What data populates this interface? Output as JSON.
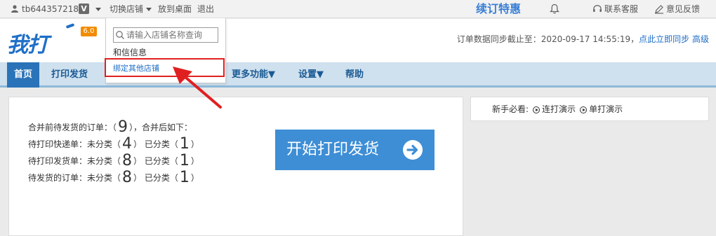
{
  "topbar": {
    "username": "tb644357218",
    "v_badge": "V",
    "switch_shop": "切换店铺",
    "to_desktop": "放到桌面",
    "logout": "退出",
    "promo": "续订特惠",
    "contact": "联系客服",
    "feedback": "意见反馈"
  },
  "header": {
    "logo": "我打",
    "version": "6.0",
    "sync_text": "订单数据同步截止至：2020-09-17 14:55:19，",
    "sync_link": "点此立即同步",
    "advanced_link": "高级"
  },
  "nav": {
    "tabs": [
      {
        "label": "首页"
      },
      {
        "label": "打印发货"
      },
      {
        "label": "更多功能▼"
      },
      {
        "label": "设置▼"
      },
      {
        "label": "帮助"
      }
    ]
  },
  "dropdown": {
    "search_placeholder": "请输入店铺名称查询",
    "shop_name": "和信信息",
    "bind_link": "绑定其他店铺"
  },
  "sidebar": {
    "label": "新手必看:",
    "link1": "连打演示",
    "link2": "单打演示"
  },
  "stats": {
    "line1_prefix": "合并前待发货的订单：（",
    "line1_count": "9",
    "line1_suffix": "），合并后如下：",
    "rows": [
      {
        "label": "待打印快递单：未分类（",
        "unclassified": "4",
        "mid": "）  已分类（",
        "classified": "1",
        "end": "）"
      },
      {
        "label": "待打印发货单：未分类（",
        "unclassified": "8",
        "mid": "）  已分类（",
        "classified": "1",
        "end": "）"
      },
      {
        "label": "待发货的订单：未分类（",
        "unclassified": "8",
        "mid": "）  已分类（",
        "classified": "1",
        "end": "）"
      }
    ]
  },
  "start_button": "开始打印发货",
  "colors": {
    "accent": "#3e8ed6",
    "nav_bg": "#cfe0ee",
    "nav_active": "#2a73b8",
    "highlight": "#e02020",
    "version_badge": "#f28b00"
  }
}
